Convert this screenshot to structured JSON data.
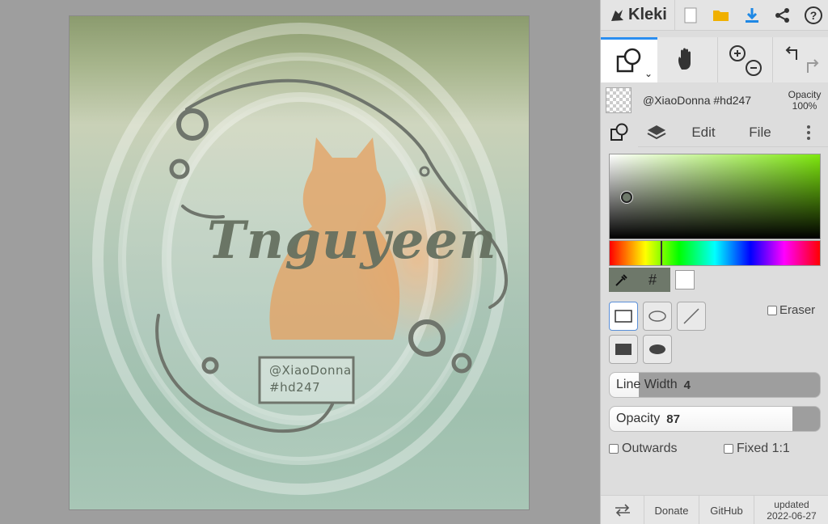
{
  "app": {
    "name": "Kleki"
  },
  "colors": {
    "accent": "#2b8ef0",
    "primary": "#6e786a",
    "secondary": "#ffffff",
    "hue_mark": "#7ee80e"
  },
  "topbar": {
    "icons": [
      "new-file-icon",
      "open-folder-icon",
      "download-icon",
      "share-icon",
      "help-icon"
    ]
  },
  "tools": {
    "items": [
      "shape-tool",
      "hand-tool",
      "zoom",
      "undo-redo"
    ]
  },
  "layer": {
    "name": "@XiaoDonna #hd247",
    "opacity_label": "Opacity",
    "opacity_value": "100%"
  },
  "tabs": {
    "edit": "Edit",
    "file": "File"
  },
  "shape": {
    "eraser_label": "Eraser",
    "line_width_label": "Line Width",
    "line_width_value": "4",
    "line_width_fraction": 0.14,
    "opacity_label": "Opacity",
    "opacity_value": "87",
    "opacity_fraction": 0.87,
    "outwards_label": "Outwards",
    "fixed_label": "Fixed 1:1",
    "hex_symbol": "#"
  },
  "canvas": {
    "brand_text": "Tnguyeen",
    "watermark_line1": "@XiaoDonna",
    "watermark_line2": "#hd247"
  },
  "footer": {
    "donate": "Donate",
    "github": "GitHub",
    "updated_label": "updated",
    "updated_date": "2022-06-27"
  }
}
